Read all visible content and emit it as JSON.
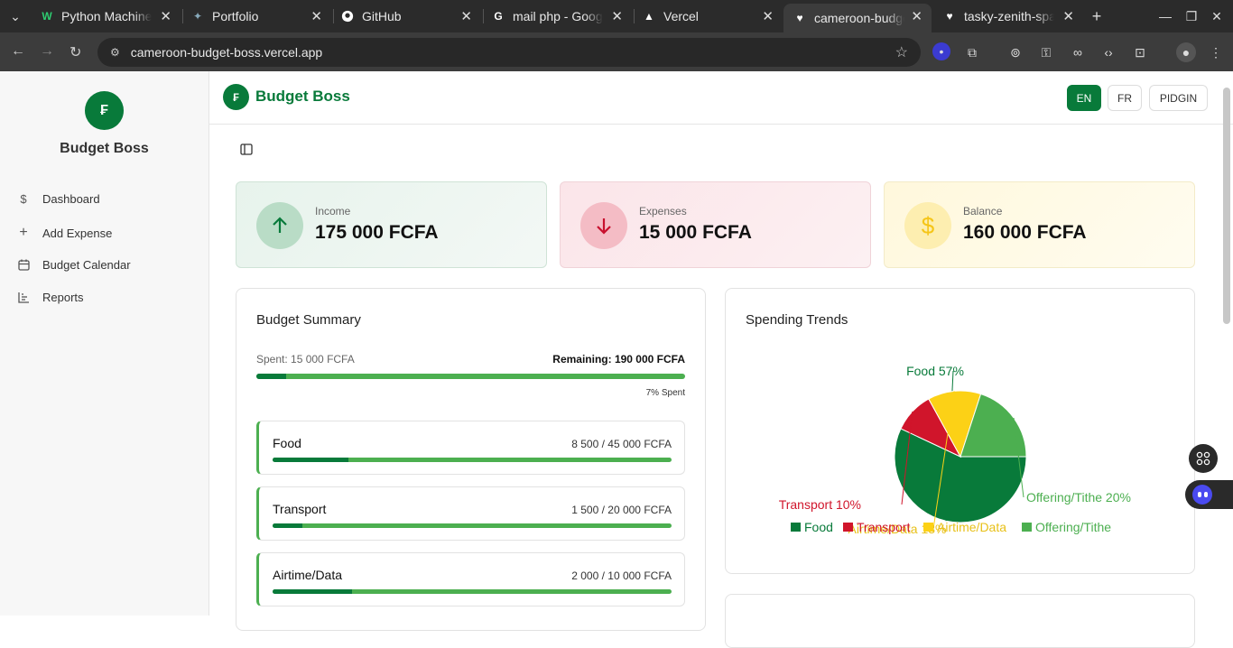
{
  "browser": {
    "tabs": [
      {
        "title": "Python Machine",
        "favicon": "w-icon"
      },
      {
        "title": "Portfolio",
        "favicon": "portfolio-icon"
      },
      {
        "title": "GitHub",
        "favicon": "github-icon"
      },
      {
        "title": "mail php - Google",
        "favicon": "google-icon"
      },
      {
        "title": "Vercel",
        "favicon": "vercel-icon"
      },
      {
        "title": "cameroon-budge",
        "favicon": "heart-icon"
      },
      {
        "title": "tasky-zenith-spar",
        "favicon": "heart-icon"
      }
    ],
    "url": "cameroon-budget-boss.vercel.app"
  },
  "sidebar": {
    "logo_glyph": "₣",
    "title": "Budget Boss",
    "items": [
      {
        "label": "Dashboard",
        "icon": "dollar-icon"
      },
      {
        "label": "Add Expense",
        "icon": "plus-icon"
      },
      {
        "label": "Budget Calendar",
        "icon": "calendar-icon"
      },
      {
        "label": "Reports",
        "icon": "chart-icon"
      }
    ]
  },
  "header": {
    "logo_glyph": "₣",
    "title": "Budget Boss",
    "languages": [
      "EN",
      "FR",
      "PIDGIN"
    ],
    "active_language": "EN"
  },
  "stats": {
    "income": {
      "label": "Income",
      "value": "175 000 FCFA"
    },
    "expenses": {
      "label": "Expenses",
      "value": "15 000 FCFA"
    },
    "balance": {
      "label": "Balance",
      "value": "160 000 FCFA"
    }
  },
  "budget_summary": {
    "title": "Budget Summary",
    "spent_label": "Spent: 15 000 FCFA",
    "remaining_label": "Remaining: 190 000 FCFA",
    "percent_label": "7% Spent",
    "percent": 7,
    "categories": [
      {
        "name": "Food",
        "value": "8 500 / 45 000 FCFA",
        "fraction": 0.189
      },
      {
        "name": "Transport",
        "value": "1 500 / 20 000 FCFA",
        "fraction": 0.075
      },
      {
        "name": "Airtime/Data",
        "value": "2 000 / 10 000 FCFA",
        "fraction": 0.2
      }
    ]
  },
  "spending_trends": {
    "title": "Spending Trends"
  },
  "chart_data": {
    "type": "pie",
    "categories": [
      "Food",
      "Transport",
      "Airtime/Data",
      "Offering/Tithe"
    ],
    "values": [
      57,
      10,
      13,
      20
    ],
    "slice_labels": [
      "Food 57%",
      "Transport 10%",
      "Airtime/Data 13%",
      "Offering/Tithe 20%"
    ],
    "colors": [
      "#087a3a",
      "#d0152b",
      "#fcd116",
      "#4caf50"
    ],
    "legend_placement": "bottom"
  },
  "colors": {
    "primary": "#087a3a",
    "income_bg": "#eef6f1",
    "expense_bg": "#fcecef",
    "balance_bg": "#fffbe8"
  }
}
